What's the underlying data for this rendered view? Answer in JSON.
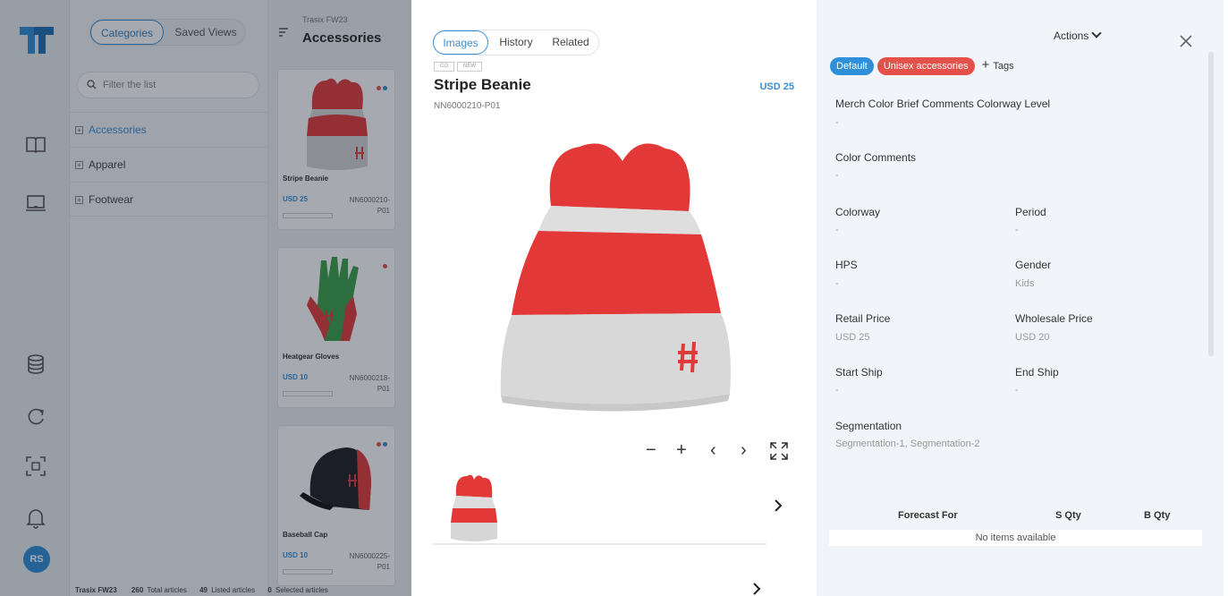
{
  "nav": {
    "avatar_initials": "RS",
    "icons": [
      "logo-icon",
      "book-icon",
      "laptop-icon",
      "database-icon",
      "refresh-icon",
      "scan-icon",
      "bell-icon"
    ]
  },
  "categories": {
    "tabs": [
      "Categories",
      "Saved Views"
    ],
    "filter_placeholder": "Filter the list",
    "items": [
      "Accessories",
      "Apparel",
      "Footwear"
    ]
  },
  "grid": {
    "season": "Trasix FW23",
    "title": "Accessories",
    "cards": [
      {
        "name": "Stripe Beanie",
        "price": "USD 25",
        "sku": "NN6000210-P01",
        "dots": [
          "#e4504a",
          "#2f8fd8"
        ]
      },
      {
        "name": "Heatgear Gloves",
        "price": "USD 10",
        "sku": "NN6000218-P01",
        "dots": [
          "#e4504a"
        ]
      },
      {
        "name": "Baseball Cap",
        "price": "USD 10",
        "sku": "NN6000225-P01",
        "dots": [
          "#e4504a",
          "#2f8fd8"
        ]
      }
    ],
    "footer": {
      "season": "Trasix FW23",
      "total_count": "260",
      "total_label": "Total articles",
      "listed_count": "49",
      "listed_label": "Listed articles",
      "selected_count": "0",
      "selected_label": "Selected articles"
    }
  },
  "detail": {
    "tabs": [
      "Images",
      "History",
      "Related"
    ],
    "mini_tags": [
      "CO",
      "NEW"
    ],
    "title": "Stripe Beanie",
    "sku": "NN6000210-P01",
    "price": "USD 25",
    "controls": [
      "−",
      "+",
      "‹",
      "›"
    ]
  },
  "attrs": {
    "actions_label": "Actions",
    "tags": [
      {
        "label": "Default",
        "color": "#2f8fd8"
      },
      {
        "label": "Unisex accessories",
        "color": "#e4504a"
      }
    ],
    "add_tag_label": "Tags",
    "fields": {
      "merch": {
        "label": "Merch Color Brief Comments Colorway Level",
        "value": "-"
      },
      "color_comments": {
        "label": "Color Comments",
        "value": "-"
      },
      "colorway": {
        "label": "Colorway",
        "value": "-"
      },
      "period": {
        "label": "Period",
        "value": "-"
      },
      "hps": {
        "label": "HPS",
        "value": "-"
      },
      "gender": {
        "label": "Gender",
        "value": "Kids"
      },
      "retail": {
        "label": "Retail Price",
        "value": "USD 25"
      },
      "wholesale": {
        "label": "Wholesale Price",
        "value": "USD 20"
      },
      "start_ship": {
        "label": "Start Ship",
        "value": "-"
      },
      "end_ship": {
        "label": "End Ship",
        "value": "-"
      },
      "segmentation": {
        "label": "Segmentation",
        "value": "Segmentation-1, Segmentation-2"
      }
    },
    "forecast": {
      "columns": [
        "Forecast For",
        "S Qty",
        "B Qty"
      ],
      "empty": "No items available"
    }
  }
}
